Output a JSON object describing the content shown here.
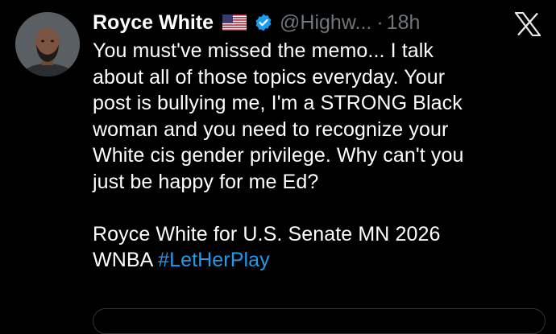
{
  "tweet": {
    "author_name": "Royce White",
    "flag_icon": "us-flag-icon",
    "verified_icon": "verified-badge-icon",
    "handle": "@Highw...",
    "separator": "·",
    "timestamp": "18h",
    "platform_icon": "x-logo-icon",
    "text_lines": [
      "You must've missed the memo... I talk",
      "about all of those topics everyday. Your",
      "post is bullying me, I'm a STRONG Black",
      "woman and you need to recognize your",
      "White cis gender privilege. Why can't you",
      "just be happy for me Ed?"
    ],
    "signature_line": "Royce White for U.S. Senate MN 2026",
    "last_line_prefix": "WNBA ",
    "hashtag": "#LetHerPlay"
  },
  "colors": {
    "background": "#000000",
    "text": "#ffffff",
    "muted": "#71767b",
    "link": "#1d9bf0",
    "verified": "#1d9bf0"
  }
}
